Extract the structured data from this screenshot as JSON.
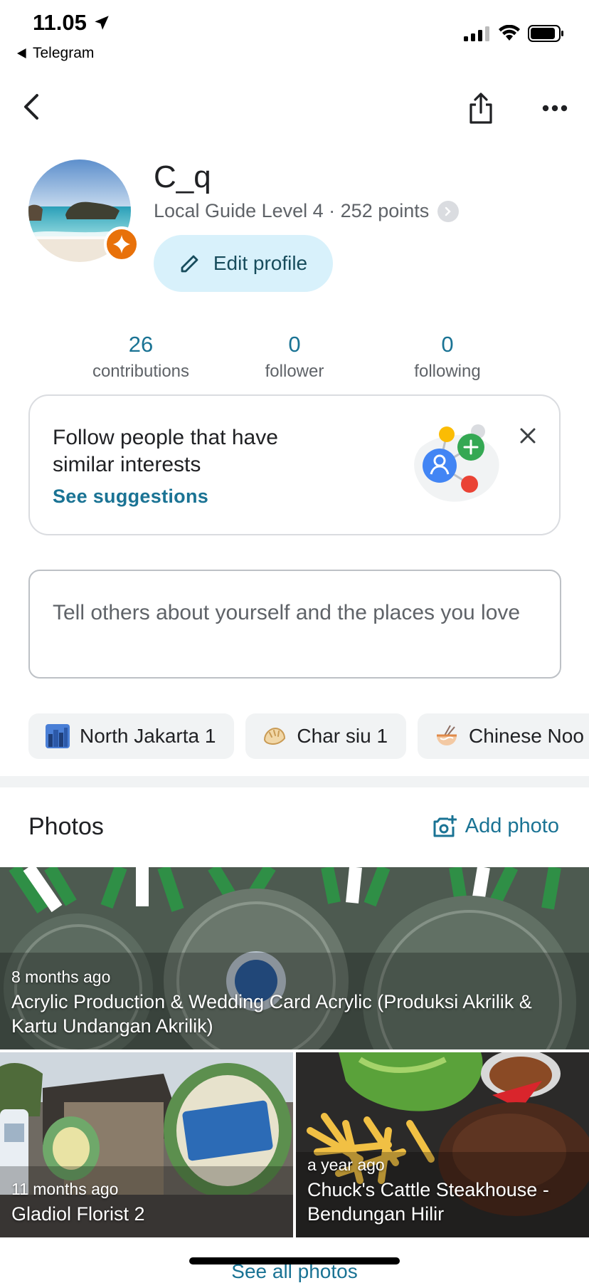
{
  "status_bar": {
    "time": "11.05",
    "back_app": "Telegram"
  },
  "profile": {
    "name": "C_q",
    "level_text": "Local Guide Level 4 · 252 points",
    "edit_label": "Edit profile"
  },
  "stats": [
    {
      "value": "26",
      "label": "contributions"
    },
    {
      "value": "0",
      "label": "follower"
    },
    {
      "value": "0",
      "label": "following"
    }
  ],
  "suggestion": {
    "title": "Follow people that have similar interests",
    "link": "See suggestions"
  },
  "bio": {
    "placeholder": "Tell others about yourself and the places you love"
  },
  "chips": [
    {
      "label": "North Jakarta 1",
      "icon": "cityscape-icon"
    },
    {
      "label": "Char siu 1",
      "icon": "dumpling-icon"
    },
    {
      "label": "Chinese Noo",
      "icon": "noodle-bowl-icon"
    }
  ],
  "photos_section": {
    "title": "Photos",
    "add_label": "Add photo",
    "see_all": "See all photos"
  },
  "photos": [
    {
      "ago": "8 months ago",
      "place": "Acrylic Production & Wedding Card Acrylic (Produksi Akrilik & Kartu Undangan Akrilik)"
    },
    {
      "ago": "11 months ago",
      "place": "Gladiol Florist 2"
    },
    {
      "ago": "a year ago",
      "place": "Chuck's Cattle Steakhouse - Bendungan Hilir"
    }
  ],
  "colors": {
    "accent": "#1a7394",
    "edit_button_bg": "#d8f1fb",
    "badge": "#e8710a"
  }
}
